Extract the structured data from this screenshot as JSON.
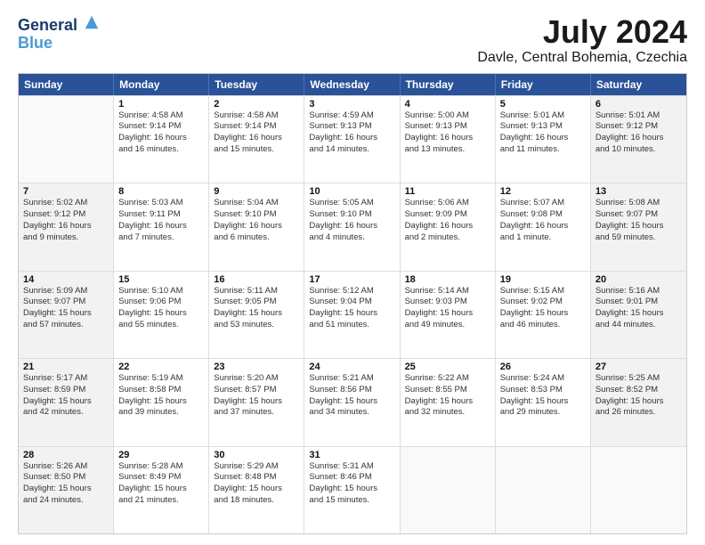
{
  "header": {
    "logo_line1": "General",
    "logo_line2": "Blue",
    "title": "July 2024",
    "subtitle": "Davle, Central Bohemia, Czechia"
  },
  "calendar": {
    "weekdays": [
      "Sunday",
      "Monday",
      "Tuesday",
      "Wednesday",
      "Thursday",
      "Friday",
      "Saturday"
    ],
    "rows": [
      [
        {
          "day": "",
          "lines": [],
          "shaded": false
        },
        {
          "day": "1",
          "lines": [
            "Sunrise: 4:58 AM",
            "Sunset: 9:14 PM",
            "Daylight: 16 hours",
            "and 16 minutes."
          ],
          "shaded": false
        },
        {
          "day": "2",
          "lines": [
            "Sunrise: 4:58 AM",
            "Sunset: 9:14 PM",
            "Daylight: 16 hours",
            "and 15 minutes."
          ],
          "shaded": false
        },
        {
          "day": "3",
          "lines": [
            "Sunrise: 4:59 AM",
            "Sunset: 9:13 PM",
            "Daylight: 16 hours",
            "and 14 minutes."
          ],
          "shaded": false
        },
        {
          "day": "4",
          "lines": [
            "Sunrise: 5:00 AM",
            "Sunset: 9:13 PM",
            "Daylight: 16 hours",
            "and 13 minutes."
          ],
          "shaded": false
        },
        {
          "day": "5",
          "lines": [
            "Sunrise: 5:01 AM",
            "Sunset: 9:13 PM",
            "Daylight: 16 hours",
            "and 11 minutes."
          ],
          "shaded": false
        },
        {
          "day": "6",
          "lines": [
            "Sunrise: 5:01 AM",
            "Sunset: 9:12 PM",
            "Daylight: 16 hours",
            "and 10 minutes."
          ],
          "shaded": true
        }
      ],
      [
        {
          "day": "7",
          "lines": [
            "Sunrise: 5:02 AM",
            "Sunset: 9:12 PM",
            "Daylight: 16 hours",
            "and 9 minutes."
          ],
          "shaded": true
        },
        {
          "day": "8",
          "lines": [
            "Sunrise: 5:03 AM",
            "Sunset: 9:11 PM",
            "Daylight: 16 hours",
            "and 7 minutes."
          ],
          "shaded": false
        },
        {
          "day": "9",
          "lines": [
            "Sunrise: 5:04 AM",
            "Sunset: 9:10 PM",
            "Daylight: 16 hours",
            "and 6 minutes."
          ],
          "shaded": false
        },
        {
          "day": "10",
          "lines": [
            "Sunrise: 5:05 AM",
            "Sunset: 9:10 PM",
            "Daylight: 16 hours",
            "and 4 minutes."
          ],
          "shaded": false
        },
        {
          "day": "11",
          "lines": [
            "Sunrise: 5:06 AM",
            "Sunset: 9:09 PM",
            "Daylight: 16 hours",
            "and 2 minutes."
          ],
          "shaded": false
        },
        {
          "day": "12",
          "lines": [
            "Sunrise: 5:07 AM",
            "Sunset: 9:08 PM",
            "Daylight: 16 hours",
            "and 1 minute."
          ],
          "shaded": false
        },
        {
          "day": "13",
          "lines": [
            "Sunrise: 5:08 AM",
            "Sunset: 9:07 PM",
            "Daylight: 15 hours",
            "and 59 minutes."
          ],
          "shaded": true
        }
      ],
      [
        {
          "day": "14",
          "lines": [
            "Sunrise: 5:09 AM",
            "Sunset: 9:07 PM",
            "Daylight: 15 hours",
            "and 57 minutes."
          ],
          "shaded": true
        },
        {
          "day": "15",
          "lines": [
            "Sunrise: 5:10 AM",
            "Sunset: 9:06 PM",
            "Daylight: 15 hours",
            "and 55 minutes."
          ],
          "shaded": false
        },
        {
          "day": "16",
          "lines": [
            "Sunrise: 5:11 AM",
            "Sunset: 9:05 PM",
            "Daylight: 15 hours",
            "and 53 minutes."
          ],
          "shaded": false
        },
        {
          "day": "17",
          "lines": [
            "Sunrise: 5:12 AM",
            "Sunset: 9:04 PM",
            "Daylight: 15 hours",
            "and 51 minutes."
          ],
          "shaded": false
        },
        {
          "day": "18",
          "lines": [
            "Sunrise: 5:14 AM",
            "Sunset: 9:03 PM",
            "Daylight: 15 hours",
            "and 49 minutes."
          ],
          "shaded": false
        },
        {
          "day": "19",
          "lines": [
            "Sunrise: 5:15 AM",
            "Sunset: 9:02 PM",
            "Daylight: 15 hours",
            "and 46 minutes."
          ],
          "shaded": false
        },
        {
          "day": "20",
          "lines": [
            "Sunrise: 5:16 AM",
            "Sunset: 9:01 PM",
            "Daylight: 15 hours",
            "and 44 minutes."
          ],
          "shaded": true
        }
      ],
      [
        {
          "day": "21",
          "lines": [
            "Sunrise: 5:17 AM",
            "Sunset: 8:59 PM",
            "Daylight: 15 hours",
            "and 42 minutes."
          ],
          "shaded": true
        },
        {
          "day": "22",
          "lines": [
            "Sunrise: 5:19 AM",
            "Sunset: 8:58 PM",
            "Daylight: 15 hours",
            "and 39 minutes."
          ],
          "shaded": false
        },
        {
          "day": "23",
          "lines": [
            "Sunrise: 5:20 AM",
            "Sunset: 8:57 PM",
            "Daylight: 15 hours",
            "and 37 minutes."
          ],
          "shaded": false
        },
        {
          "day": "24",
          "lines": [
            "Sunrise: 5:21 AM",
            "Sunset: 8:56 PM",
            "Daylight: 15 hours",
            "and 34 minutes."
          ],
          "shaded": false
        },
        {
          "day": "25",
          "lines": [
            "Sunrise: 5:22 AM",
            "Sunset: 8:55 PM",
            "Daylight: 15 hours",
            "and 32 minutes."
          ],
          "shaded": false
        },
        {
          "day": "26",
          "lines": [
            "Sunrise: 5:24 AM",
            "Sunset: 8:53 PM",
            "Daylight: 15 hours",
            "and 29 minutes."
          ],
          "shaded": false
        },
        {
          "day": "27",
          "lines": [
            "Sunrise: 5:25 AM",
            "Sunset: 8:52 PM",
            "Daylight: 15 hours",
            "and 26 minutes."
          ],
          "shaded": true
        }
      ],
      [
        {
          "day": "28",
          "lines": [
            "Sunrise: 5:26 AM",
            "Sunset: 8:50 PM",
            "Daylight: 15 hours",
            "and 24 minutes."
          ],
          "shaded": true
        },
        {
          "day": "29",
          "lines": [
            "Sunrise: 5:28 AM",
            "Sunset: 8:49 PM",
            "Daylight: 15 hours",
            "and 21 minutes."
          ],
          "shaded": false
        },
        {
          "day": "30",
          "lines": [
            "Sunrise: 5:29 AM",
            "Sunset: 8:48 PM",
            "Daylight: 15 hours",
            "and 18 minutes."
          ],
          "shaded": false
        },
        {
          "day": "31",
          "lines": [
            "Sunrise: 5:31 AM",
            "Sunset: 8:46 PM",
            "Daylight: 15 hours",
            "and 15 minutes."
          ],
          "shaded": false
        },
        {
          "day": "",
          "lines": [],
          "shaded": false
        },
        {
          "day": "",
          "lines": [],
          "shaded": false
        },
        {
          "day": "",
          "lines": [],
          "shaded": false
        }
      ]
    ]
  }
}
